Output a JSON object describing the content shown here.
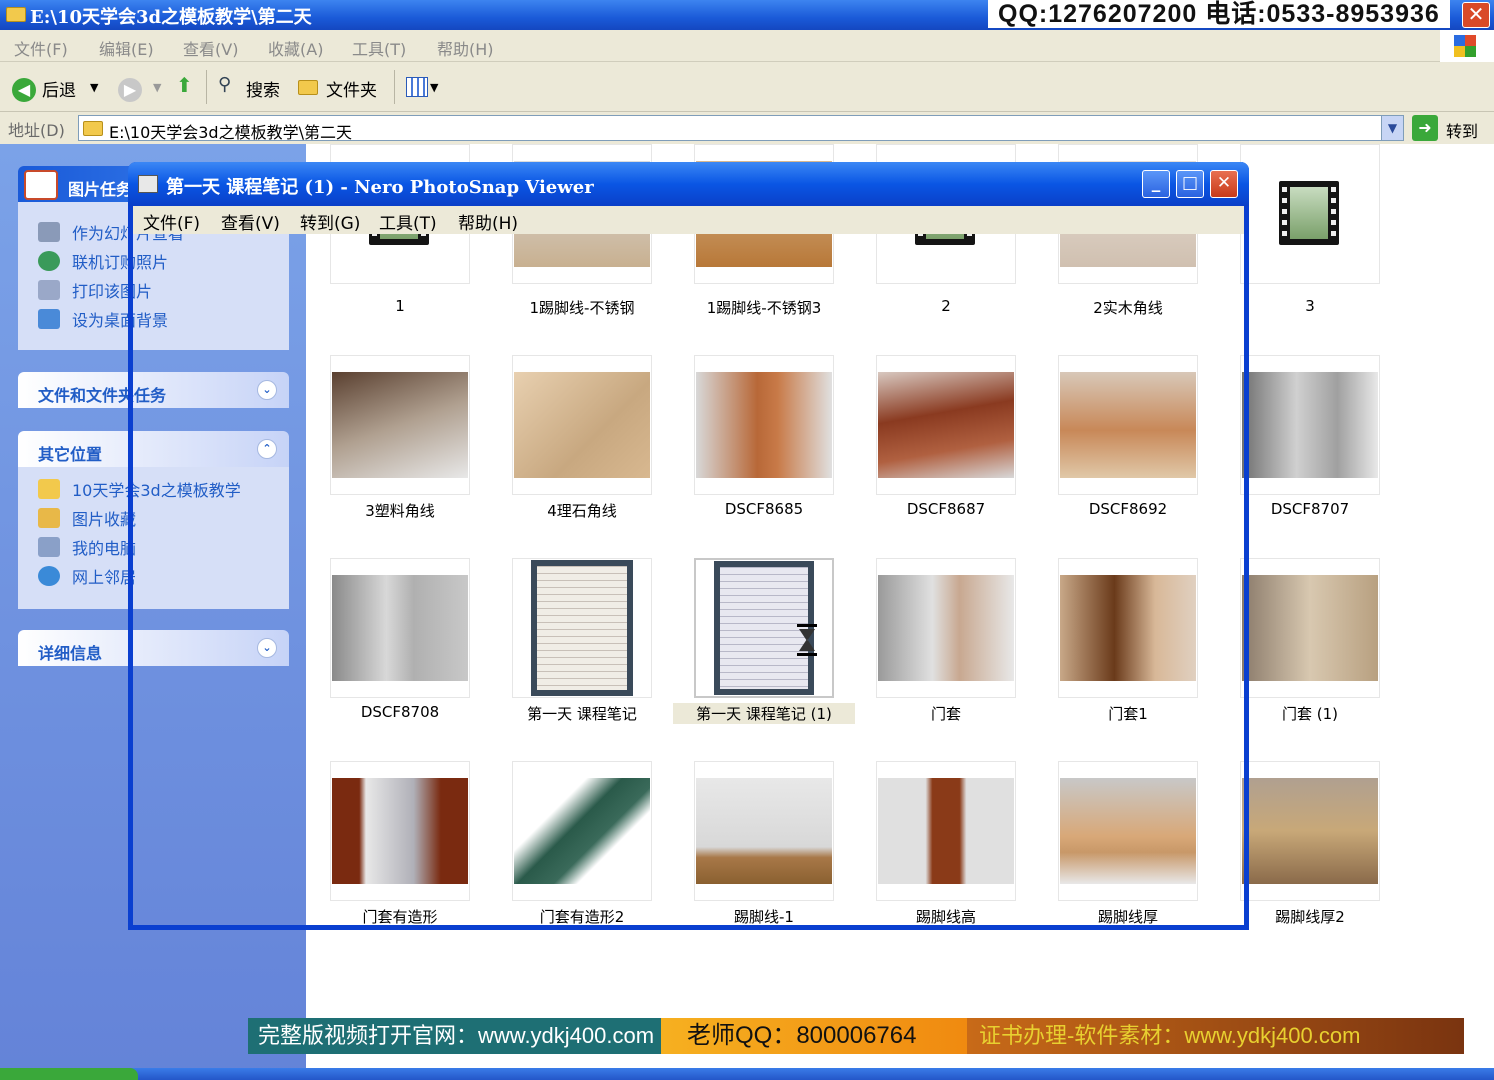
{
  "explorer": {
    "title": "E:\\10天学会3d之模板教学\\第二天",
    "contact": "QQ:1276207200 电话:0533-8953936",
    "close_label": "✕",
    "menu": [
      "文件(F)",
      "编辑(E)",
      "查看(V)",
      "收藏(A)",
      "工具(T)",
      "帮助(H)"
    ],
    "toolbar": {
      "back": "后退",
      "search": "搜索",
      "folders": "文件夹"
    },
    "address": {
      "label": "地址(D)",
      "path": "E:\\10天学会3d之模板教学\\第二天",
      "go": "转到"
    }
  },
  "sidebar": {
    "picture_tasks": {
      "title": "图片任务",
      "items": [
        "作为幻灯片查看",
        "联机订购照片",
        "打印该图片",
        "设为桌面背景"
      ]
    },
    "file_tasks": {
      "title": "文件和文件夹任务"
    },
    "other_places": {
      "title": "其它位置",
      "items": [
        "10天学会3d之模板教学",
        "图片收藏",
        "我的电脑",
        "网上邻居"
      ]
    },
    "details": {
      "title": "详细信息"
    }
  },
  "files": [
    {
      "name": "1",
      "kind": "video"
    },
    {
      "name": "1踢脚线-不锈钢",
      "kind": "photo"
    },
    {
      "name": "1踢脚线-不锈钢3",
      "kind": "photo"
    },
    {
      "name": "2",
      "kind": "video"
    },
    {
      "name": "2实木角线",
      "kind": "photo"
    },
    {
      "name": "3",
      "kind": "video"
    },
    {
      "name": "3塑料角线",
      "kind": "photo"
    },
    {
      "name": "4理石角线",
      "kind": "photo"
    },
    {
      "name": "DSCF8685",
      "kind": "photo"
    },
    {
      "name": "DSCF8687",
      "kind": "photo"
    },
    {
      "name": "DSCF8692",
      "kind": "photo"
    },
    {
      "name": "DSCF8707",
      "kind": "photo"
    },
    {
      "name": "DSCF8708",
      "kind": "photo"
    },
    {
      "name": "第一天 课程笔记",
      "kind": "photo"
    },
    {
      "name": "第一天 课程笔记 (1)",
      "kind": "photo",
      "selected": true
    },
    {
      "name": "门套",
      "kind": "photo"
    },
    {
      "name": "门套1",
      "kind": "photo"
    },
    {
      "name": "门套 (1)",
      "kind": "photo"
    },
    {
      "name": "门套有造形",
      "kind": "photo"
    },
    {
      "name": "门套有造形2",
      "kind": "photo"
    },
    {
      "name": "踢脚线-1",
      "kind": "photo"
    },
    {
      "name": "踢脚线高",
      "kind": "photo"
    },
    {
      "name": "踢脚线厚",
      "kind": "photo"
    },
    {
      "name": "踢脚线厚2",
      "kind": "photo"
    }
  ],
  "viewer": {
    "title": "第一天 课程笔记 (1) - Nero PhotoSnap Viewer",
    "menu": [
      "文件(F)",
      "查看(V)",
      "转到(G)",
      "工具(T)",
      "帮助(H)"
    ],
    "buttons": {
      "minimize": "_",
      "maximize": "□",
      "close": "✕"
    }
  },
  "banner": {
    "left": "完整版视频打开官网：www.ydkj400.com",
    "mid": "老师QQ：800006764",
    "right": "证书办理-软件素材：www.ydkj400.com"
  },
  "colors": {
    "xp_blue": "#0a56e4",
    "sidebar_link": "#215dc6",
    "banner_left": "#1e6f74",
    "banner_mid": "#f39a10",
    "banner_right": "#8a3a10"
  }
}
